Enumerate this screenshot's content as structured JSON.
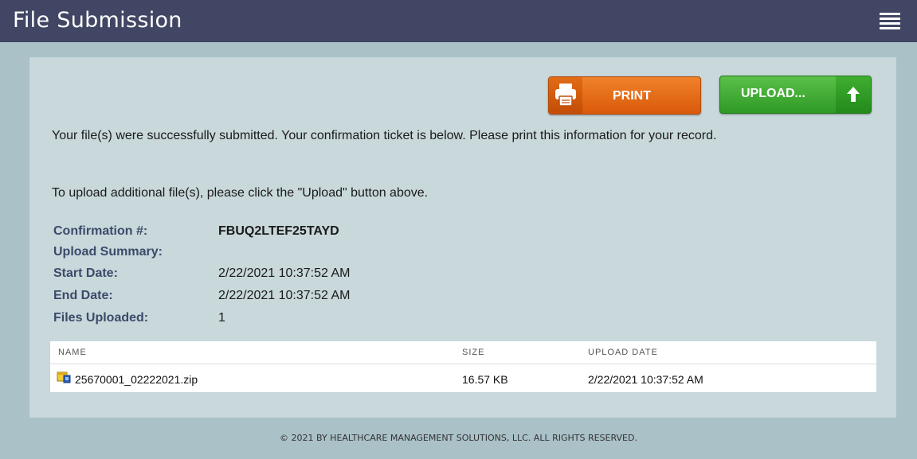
{
  "header": {
    "title": "File Submission",
    "menu_icon": "hamburger-menu-icon"
  },
  "actions": {
    "print_label": "PRINT",
    "print_icon": "printer-icon",
    "upload_label": "UPLOAD...",
    "upload_icon": "up-arrow-icon"
  },
  "messages": {
    "success": "Your file(s) were successfully submitted. Your confirmation ticket is below. Please print this information for your record.",
    "instruction": "To upload additional file(s), please click the \"Upload\" button above."
  },
  "summary": {
    "confirmation_label": "Confirmation #:",
    "confirmation_value": "FBUQ2LTEF25TAYD",
    "upload_summary_label": "Upload Summary:",
    "start_label": "Start Date:",
    "start_value": "2/22/2021 10:37:52 AM",
    "end_label": "End Date:",
    "end_value": "2/22/2021 10:37:52 AM",
    "files_label": "Files Uploaded:",
    "files_value": "1"
  },
  "files_table": {
    "columns": [
      "NAME",
      "SIZE",
      "UPLOAD DATE"
    ],
    "rows": [
      {
        "name": "25670001_02222021.zip",
        "size": "16.57 KB",
        "upload_date": "2/22/2021 10:37:52 AM",
        "icon": "zip-file-icon"
      }
    ]
  },
  "footer": {
    "copyright": "© 2021 BY HEALTHCARE MANAGEMENT SOLUTIONS, LLC. ALL RIGHTS RESERVED."
  },
  "colors": {
    "header_bg": "#404663",
    "page_bg": "#a9c1c7",
    "panel_bg": "#c8d8db",
    "print_button": "#e8701b",
    "upload_button": "#3aab2e",
    "label_color": "#3c4a6a"
  }
}
